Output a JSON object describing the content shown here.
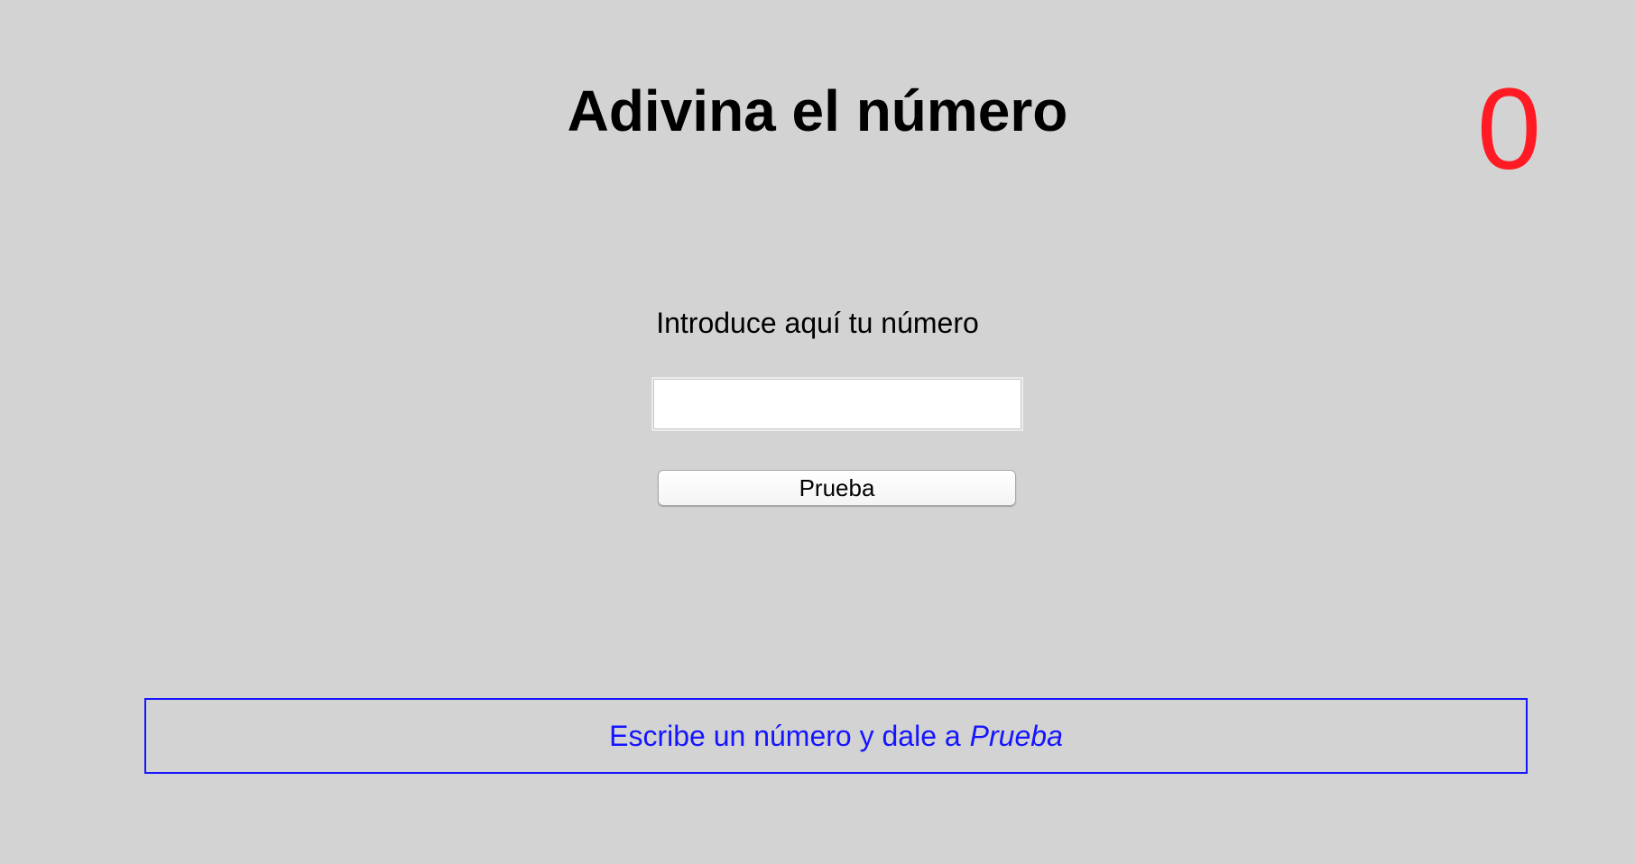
{
  "header": {
    "title": "Adivina el número",
    "counter": "0"
  },
  "form": {
    "prompt": "Introduce aquí tu número",
    "input_value": "",
    "button_label": "Prueba"
  },
  "message": {
    "text": "Escribe un número y dale a",
    "emphasis": "Prueba"
  },
  "colors": {
    "background": "#d3d3d3",
    "counter": "#ff1a24",
    "message": "#1515ff"
  }
}
